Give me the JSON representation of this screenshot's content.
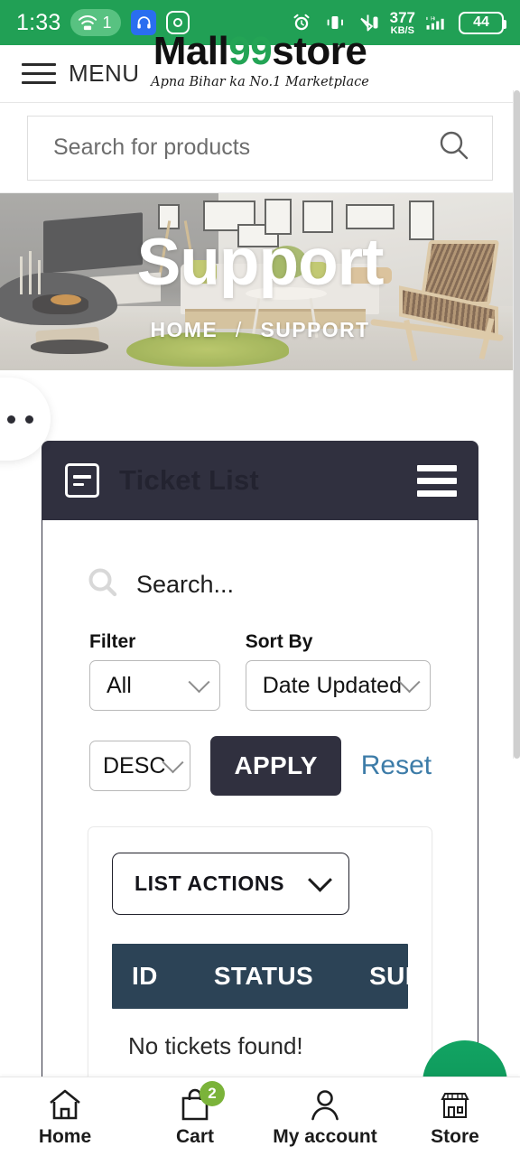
{
  "statusbar": {
    "time": "1:33",
    "wifi_count": "1",
    "network_speed_value": "377",
    "network_speed_unit": "KB/S",
    "battery": "44",
    "icons": [
      "wifi-icon",
      "headphones-icon",
      "instagram-icon",
      "alarm-clock-icon",
      "vibrate-icon",
      "bluetooth-icon",
      "signal-icon",
      "battery-icon"
    ],
    "bg_color": "#21a055"
  },
  "header": {
    "menu_label": "MENU",
    "logo_part1": "Mall",
    "logo_part2": "99",
    "logo_part3": "store",
    "logo_tagline": "Apna Bihar ka No.1 Marketplace",
    "logo_accent": "#23a455"
  },
  "search": {
    "placeholder": "Search for products"
  },
  "hero": {
    "title": "Support",
    "breadcrumb_home": "HOME",
    "breadcrumb_separator": "/",
    "breadcrumb_current": "SUPPORT"
  },
  "panel": {
    "title": "Ticket List",
    "search_placeholder": "Search...",
    "filter_label": "Filter",
    "filter_value": "All",
    "sort_label": "Sort By",
    "sort_value": "Date Updated",
    "order_value": "DESC",
    "apply_label": "APPLY",
    "reset_label": "Reset",
    "list_actions_label": "LIST ACTIONS",
    "table_headers": [
      "ID",
      "STATUS",
      "SUBJE"
    ],
    "empty_message": "No tickets found!",
    "header_bg": "#30303f",
    "table_header_bg": "#2c4356"
  },
  "fab": {
    "color": "#0f9d58"
  },
  "bottomnav": {
    "items": [
      {
        "label": "Home",
        "icon": "home-icon",
        "badge": ""
      },
      {
        "label": "Cart",
        "icon": "shopping-bag-icon",
        "badge": "2"
      },
      {
        "label": "My account",
        "icon": "user-icon",
        "badge": ""
      },
      {
        "label": "Store",
        "icon": "storefront-icon",
        "badge": ""
      }
    ],
    "badge_color": "#7bb33a"
  }
}
